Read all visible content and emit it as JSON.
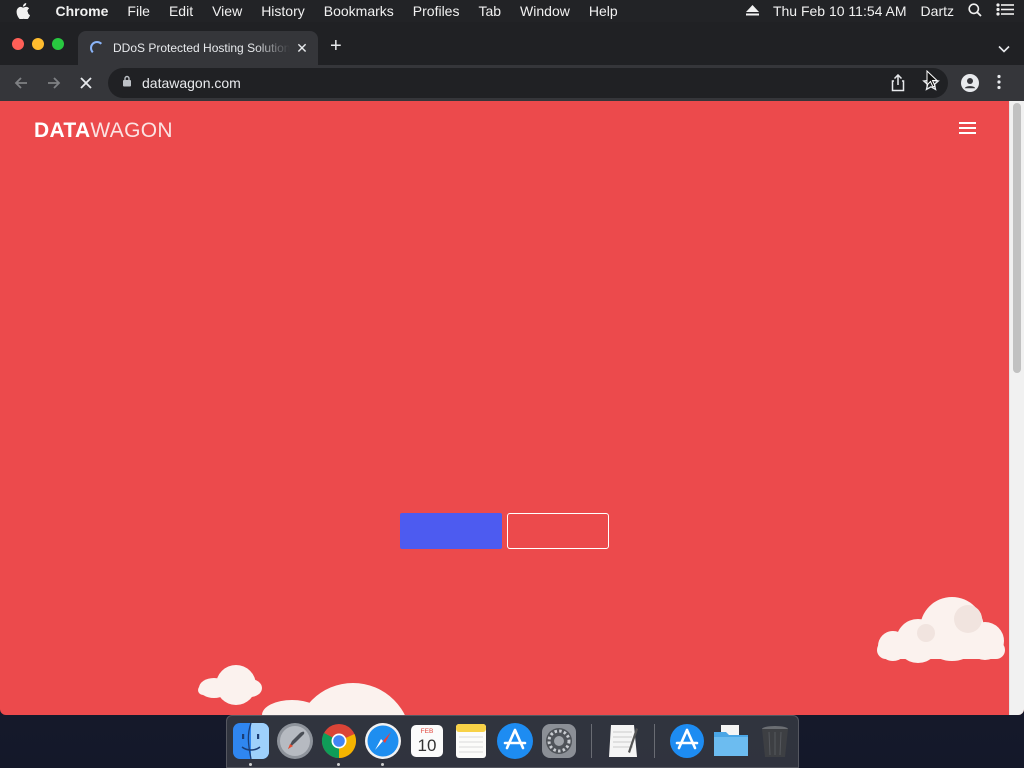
{
  "menubar": {
    "app_name": "Chrome",
    "menus": [
      "File",
      "Edit",
      "View",
      "History",
      "Bookmarks",
      "Profiles",
      "Tab",
      "Window",
      "Help"
    ],
    "datetime": "Thu Feb 10  11:54 AM",
    "user": "Dartz"
  },
  "browser": {
    "tab_title": "DDoS Protected Hosting Solutions",
    "tab_loading": true,
    "url": "datawagon.com"
  },
  "page": {
    "logo_bold": "DATA",
    "logo_light": "WAGON",
    "background_color": "#ec4a4c",
    "primary_button_color": "#4d5bf0",
    "scroll_position": 0
  },
  "dock": {
    "apps": [
      "Finder",
      "Launchpad",
      "Google Chrome",
      "Safari",
      "Calendar",
      "Notes",
      "App Store",
      "System Preferences",
      "TextEdit",
      "Applications",
      "Documents",
      "Trash"
    ],
    "calendar_month": "FEB",
    "calendar_day": "10"
  }
}
